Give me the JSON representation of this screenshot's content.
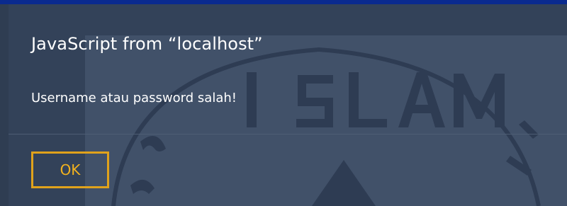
{
  "dialog": {
    "title": "JavaScript from “localhost”",
    "message": "Username atau password salah!",
    "ok_label": "OK"
  },
  "watermark": {
    "text": "ISLAM"
  },
  "colors": {
    "background": "#3b4a61",
    "accent_bar": "#0a2a8f",
    "button_border": "#e0a21b",
    "button_text": "#f2b21e",
    "text": "#ffffff"
  }
}
